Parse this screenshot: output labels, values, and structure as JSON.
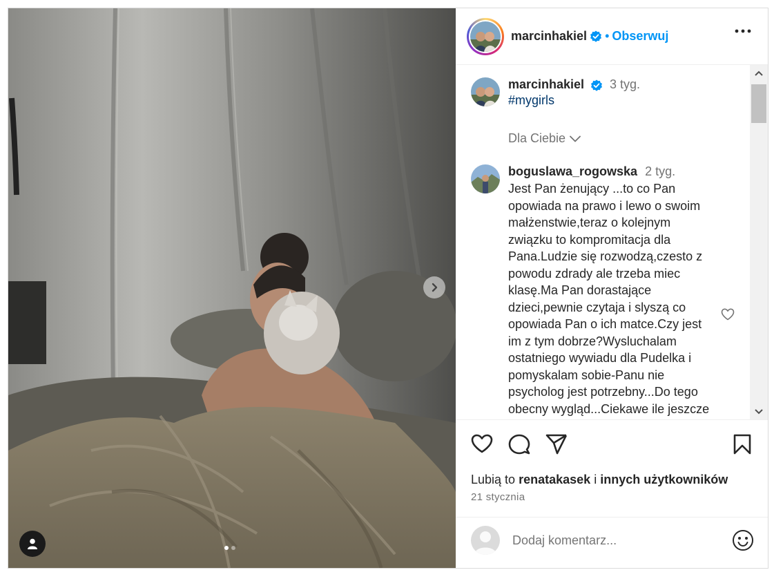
{
  "post": {
    "author": "marcinhakiel",
    "follow_label": "Obserwuj",
    "dot": "•",
    "carousel": {
      "count": 2,
      "active": 1
    }
  },
  "caption": {
    "author": "marcinhakiel",
    "time": "3 tyg.",
    "text": "#mygirls"
  },
  "sort": {
    "label": "Dla Ciebie"
  },
  "comment": {
    "author": "boguslawa_rogowska",
    "time": "2 tyg.",
    "lines": [
      "Jest Pan żenujący ...to co Pan",
      "opowiada na prawo i lewo o swoim",
      "małżenstwie,teraz o kolejnym",
      "związku to kompromitacja dla",
      "Pana.Ludzie się rozwodzą,czesto z",
      "powodu zdrady ale trzeba miec",
      "klasę.Ma Pan dorastające",
      "dzieci,pewnie czytaja i slyszą co",
      "opowiada Pan o ich matce.Czy jest",
      "im z tym dobrze?Wysluchalam",
      "ostatniego wywiadu dla Pudelka i",
      "pomyskalam sobie-Panu nie",
      "psycholog jest potrzebny...Do tego",
      "obecny wygląd...Ciekawe ile jeszcze"
    ]
  },
  "likes": {
    "prefix": "Lubią to",
    "user": "renatakasek",
    "mid": "i",
    "suffix": "innych użytkowników"
  },
  "date": "21 stycznia",
  "add_comment": {
    "placeholder": "Dodaj komentarz..."
  },
  "colors": {
    "accent": "#0095f6",
    "hashtag": "#00376b",
    "muted": "#737373"
  },
  "icons": [
    "verified-icon",
    "more-icon",
    "heart-icon",
    "comment-icon",
    "share-icon",
    "bookmark-icon",
    "emoji-icon",
    "chevron-right-icon",
    "user-tag-icon"
  ]
}
